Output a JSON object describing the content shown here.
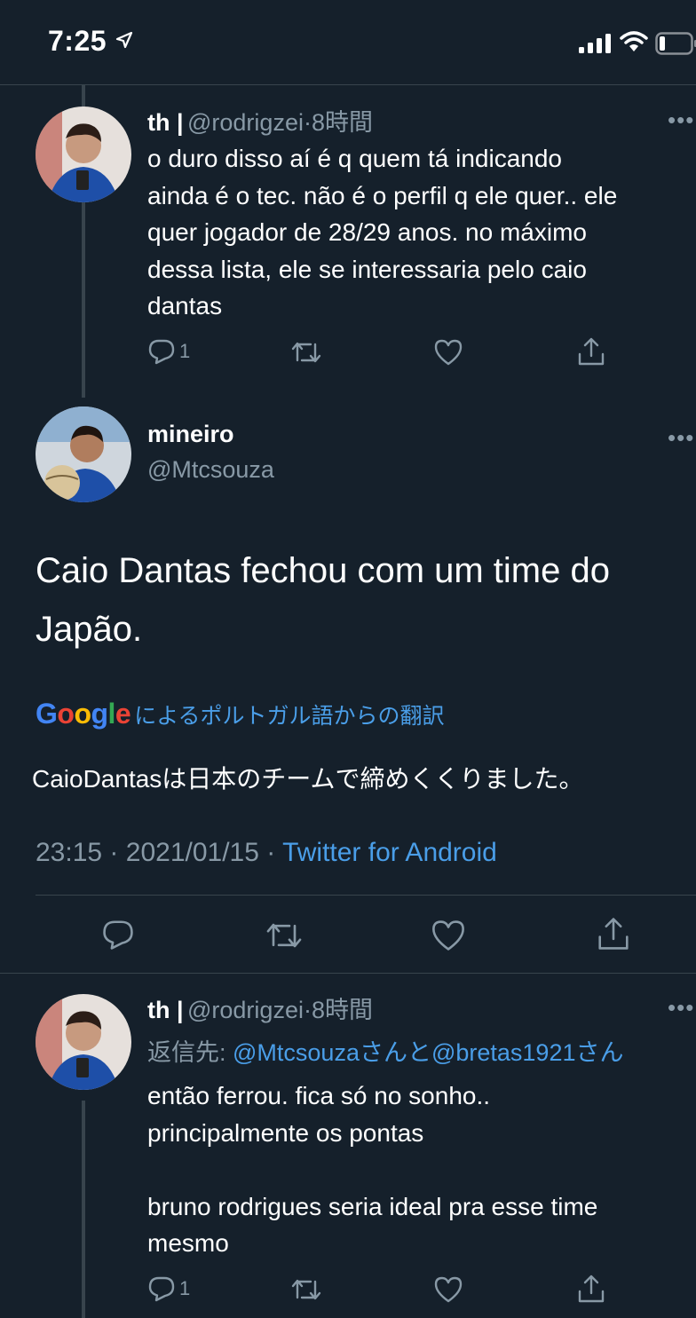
{
  "status_bar": {
    "time": "7:25"
  },
  "tweet1": {
    "name": "th |",
    "handle": "@rodrigzei",
    "dot": "·",
    "time": "8時間",
    "more": "•••",
    "lines": [
      "o duro disso aí é q quem tá indicando",
      "ainda é o tec. não é o perfil q ele quer.. ele",
      "quer jogador de 28/29 anos. no máximo",
      "dessa lista, ele se interessaria pelo caio",
      "dantas"
    ],
    "reply_count": "1"
  },
  "main_tweet": {
    "name": "mineiro",
    "handle": "@Mtcsouza",
    "more": "•••",
    "lines": [
      "Caio Dantas fechou com um time do",
      "Japão."
    ],
    "google_logo": "Google",
    "translate_label": "によるポルトガル語からの翻訳",
    "translated_text": "CaioDantasは日本のチームで締めくくりました。",
    "time": "23:15",
    "sep1": "·",
    "date": "2021/01/15",
    "sep2": "·",
    "source": "Twitter for Android"
  },
  "tweet3": {
    "name": "th |",
    "handle": "@rodrigzei",
    "dot": "·",
    "time": "8時間",
    "more": "•••",
    "reply_prefix": "返信先: ",
    "reply_to": "@Mtcsouzaさんと@bretas1921さん",
    "lines": [
      "então ferrou. fica só no sonho..",
      "principalmente os pontas",
      "",
      "bruno rodrigues seria ideal pra esse time",
      "mesmo"
    ],
    "reply_count": "1"
  },
  "colors": {
    "background": "#15202b",
    "text": "#ffffff",
    "muted": "#8899a6",
    "link": "#4a9ee8",
    "divider": "#38444d"
  },
  "icons": [
    "location-arrow-icon",
    "signal-icon",
    "wifi-icon",
    "battery-icon",
    "reply-icon",
    "retweet-icon",
    "like-icon",
    "share-icon",
    "more-icon",
    "google-logo"
  ]
}
